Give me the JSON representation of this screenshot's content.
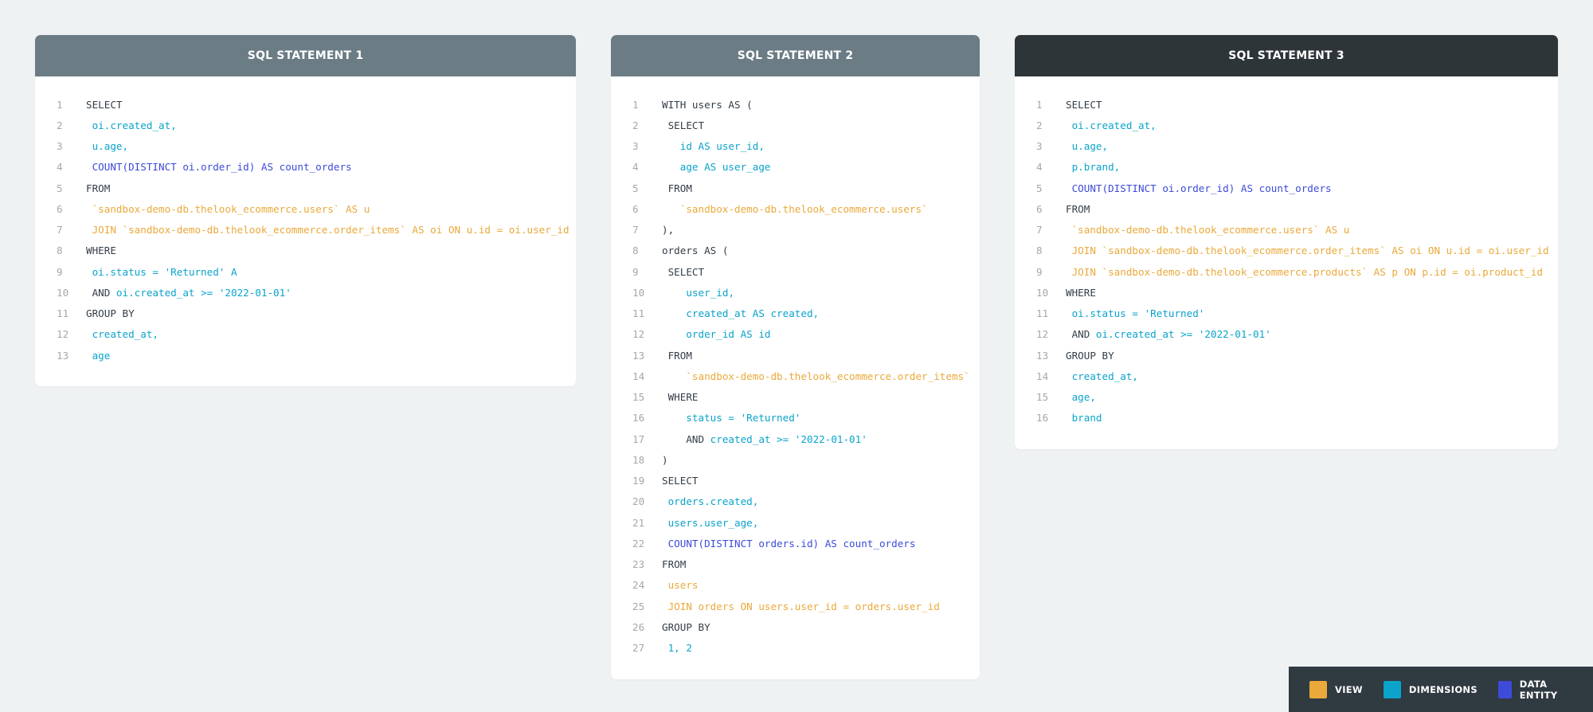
{
  "colors": {
    "view": "#eaa93a",
    "dimensions": "#0aa3cb",
    "data_entity": "#3d4bd8",
    "plain": "#333d47"
  },
  "statements": [
    {
      "title": "SQL STATEMENT 1",
      "header_color": "#6b7c85",
      "lines": [
        {
          "n": "1",
          "tokens": [
            {
              "t": "SELECT",
              "c": "plain"
            }
          ]
        },
        {
          "n": "2",
          "tokens": [
            {
              "t": " oi.created_at,",
              "c": "dim"
            }
          ]
        },
        {
          "n": "3",
          "tokens": [
            {
              "t": " u.age,",
              "c": "dim"
            }
          ]
        },
        {
          "n": "4",
          "tokens": [
            {
              "t": " COUNT(DISTINCT oi.order_id) AS count_orders",
              "c": "entity"
            }
          ]
        },
        {
          "n": "5",
          "tokens": [
            {
              "t": "FROM",
              "c": "plain"
            }
          ]
        },
        {
          "n": "6",
          "tokens": [
            {
              "t": " `sandbox-demo-db.thelook_ecommerce.users` AS u",
              "c": "view"
            }
          ]
        },
        {
          "n": "7",
          "tokens": [
            {
              "t": " JOIN `sandbox-demo-db.thelook_ecommerce.order_items` AS oi ON u.id = oi.user_id",
              "c": "view"
            }
          ]
        },
        {
          "n": "8",
          "tokens": [
            {
              "t": "WHERE",
              "c": "plain"
            }
          ]
        },
        {
          "n": "9",
          "tokens": [
            {
              "t": " oi.status = 'Returned' A",
              "c": "dim"
            }
          ]
        },
        {
          "n": "10",
          "tokens": [
            {
              "t": " AND ",
              "c": "plain"
            },
            {
              "t": "oi.created_at >= '2022-01-01'",
              "c": "dim"
            }
          ]
        },
        {
          "n": "11",
          "tokens": [
            {
              "t": "GROUP BY",
              "c": "plain"
            }
          ]
        },
        {
          "n": "12",
          "tokens": [
            {
              "t": " created_at,",
              "c": "dim"
            }
          ]
        },
        {
          "n": "13",
          "tokens": [
            {
              "t": " age",
              "c": "dim"
            }
          ]
        }
      ]
    },
    {
      "title": "SQL STATEMENT 2",
      "header_color": "#6b7c85",
      "lines": [
        {
          "n": "1",
          "tokens": [
            {
              "t": "WITH users AS (",
              "c": "plain"
            }
          ]
        },
        {
          "n": "2",
          "tokens": [
            {
              "t": " SELECT",
              "c": "plain"
            }
          ]
        },
        {
          "n": "3",
          "tokens": [
            {
              "t": "   id AS user_id,",
              "c": "dim"
            }
          ]
        },
        {
          "n": "4",
          "tokens": [
            {
              "t": "   age AS user_age",
              "c": "dim"
            }
          ]
        },
        {
          "n": "5",
          "tokens": [
            {
              "t": " FROM",
              "c": "plain"
            }
          ]
        },
        {
          "n": "6",
          "tokens": [
            {
              "t": "   `sandbox-demo-db.thelook_ecommerce.users`",
              "c": "view"
            }
          ]
        },
        {
          "n": "7",
          "tokens": [
            {
              "t": "),",
              "c": "plain"
            }
          ]
        },
        {
          "n": "8",
          "tokens": [
            {
              "t": "orders AS (",
              "c": "plain"
            }
          ]
        },
        {
          "n": "9",
          "tokens": [
            {
              "t": " SELECT",
              "c": "plain"
            }
          ]
        },
        {
          "n": "10",
          "tokens": [
            {
              "t": "    user_id,",
              "c": "dim"
            }
          ]
        },
        {
          "n": "11",
          "tokens": [
            {
              "t": "    created_at AS created,",
              "c": "dim"
            }
          ]
        },
        {
          "n": "12",
          "tokens": [
            {
              "t": "    order_id AS id",
              "c": "dim"
            }
          ]
        },
        {
          "n": "13",
          "tokens": [
            {
              "t": " FROM",
              "c": "plain"
            }
          ]
        },
        {
          "n": "14",
          "tokens": [
            {
              "t": "    `sandbox-demo-db.thelook_ecommerce.order_items`",
              "c": "view"
            }
          ]
        },
        {
          "n": "15",
          "tokens": [
            {
              "t": " WHERE",
              "c": "plain"
            }
          ]
        },
        {
          "n": "16",
          "tokens": [
            {
              "t": "    status = 'Returned'",
              "c": "dim"
            }
          ]
        },
        {
          "n": "17",
          "tokens": [
            {
              "t": "    AND ",
              "c": "plain"
            },
            {
              "t": "created_at >= '2022-01-01'",
              "c": "dim"
            }
          ]
        },
        {
          "n": "18",
          "tokens": [
            {
              "t": ")",
              "c": "plain"
            }
          ]
        },
        {
          "n": "19",
          "tokens": [
            {
              "t": "SELECT",
              "c": "plain"
            }
          ]
        },
        {
          "n": "20",
          "tokens": [
            {
              "t": " orders.created,",
              "c": "dim"
            }
          ]
        },
        {
          "n": "21",
          "tokens": [
            {
              "t": " users.user_age,",
              "c": "dim"
            }
          ]
        },
        {
          "n": "22",
          "tokens": [
            {
              "t": " COUNT(DISTINCT orders.id) AS count_orders",
              "c": "entity"
            }
          ]
        },
        {
          "n": "23",
          "tokens": [
            {
              "t": "FROM",
              "c": "plain"
            }
          ]
        },
        {
          "n": "24",
          "tokens": [
            {
              "t": " users",
              "c": "view"
            }
          ]
        },
        {
          "n": "25",
          "tokens": [
            {
              "t": " JOIN orders ON users.user_id = orders.user_id",
              "c": "view"
            }
          ]
        },
        {
          "n": "26",
          "tokens": [
            {
              "t": "GROUP BY",
              "c": "plain"
            }
          ]
        },
        {
          "n": "27",
          "tokens": [
            {
              "t": " 1, 2",
              "c": "dim"
            }
          ]
        }
      ]
    },
    {
      "title": "SQL STATEMENT 3",
      "header_color": "#2e3539",
      "lines": [
        {
          "n": "1",
          "tokens": [
            {
              "t": "SELECT",
              "c": "plain"
            }
          ]
        },
        {
          "n": "2",
          "tokens": [
            {
              "t": " oi.created_at,",
              "c": "dim"
            }
          ]
        },
        {
          "n": "3",
          "tokens": [
            {
              "t": " u.age,",
              "c": "dim"
            }
          ]
        },
        {
          "n": "4",
          "tokens": [
            {
              "t": " p.brand,",
              "c": "dim"
            }
          ]
        },
        {
          "n": "5",
          "tokens": [
            {
              "t": " COUNT(DISTINCT oi.order_id) AS count_orders",
              "c": "entity"
            }
          ]
        },
        {
          "n": "6",
          "tokens": [
            {
              "t": "FROM",
              "c": "plain"
            }
          ]
        },
        {
          "n": "7",
          "tokens": [
            {
              "t": " `sandbox-demo-db.thelook_ecommerce.users` AS u",
              "c": "view"
            }
          ]
        },
        {
          "n": "8",
          "tokens": [
            {
              "t": " JOIN `sandbox-demo-db.thelook_ecommerce.order_items` AS oi ON u.id = oi.user_id",
              "c": "view"
            }
          ]
        },
        {
          "n": "9",
          "tokens": [
            {
              "t": " JOIN `sandbox-demo-db.thelook_ecommerce.products` AS p ON p.id = oi.product_id",
              "c": "view"
            }
          ]
        },
        {
          "n": "10",
          "tokens": [
            {
              "t": "WHERE",
              "c": "plain"
            }
          ]
        },
        {
          "n": "11",
          "tokens": [
            {
              "t": " oi.status = 'Returned'",
              "c": "dim"
            }
          ]
        },
        {
          "n": "12",
          "tokens": [
            {
              "t": " AND ",
              "c": "plain"
            },
            {
              "t": "oi.created_at >= '2022-01-01'",
              "c": "dim"
            }
          ]
        },
        {
          "n": "13",
          "tokens": [
            {
              "t": "GROUP BY",
              "c": "plain"
            }
          ]
        },
        {
          "n": "14",
          "tokens": [
            {
              "t": " created_at,",
              "c": "dim"
            }
          ]
        },
        {
          "n": "15",
          "tokens": [
            {
              "t": " age,",
              "c": "dim"
            }
          ]
        },
        {
          "n": "16",
          "tokens": [
            {
              "t": " brand",
              "c": "dim"
            }
          ]
        }
      ]
    }
  ],
  "legend": {
    "items": [
      {
        "label": "VIEW",
        "color": "#eaa93a"
      },
      {
        "label": "DIMENSIONS",
        "color": "#0aa3cb"
      },
      {
        "label": "DATA ENTITY",
        "color": "#3d4bd8"
      }
    ]
  }
}
